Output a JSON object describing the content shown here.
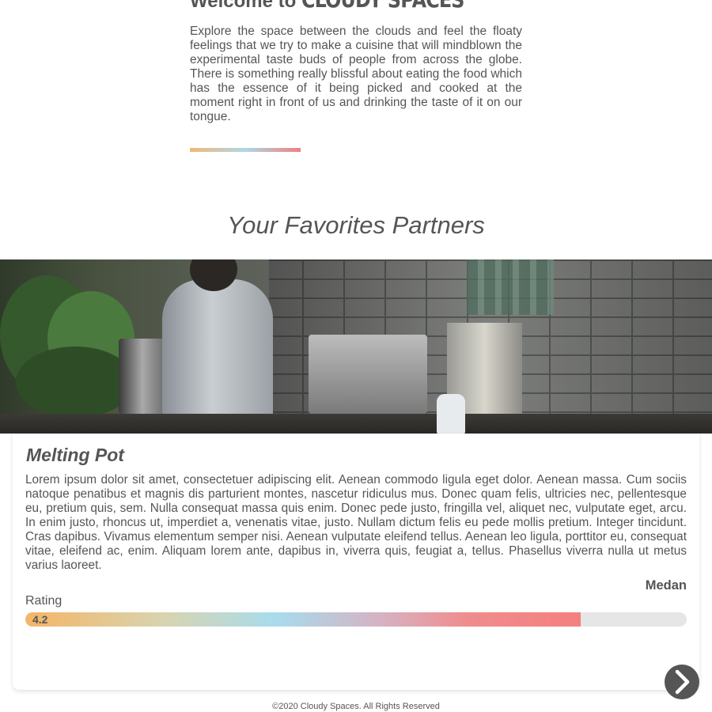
{
  "welcome": {
    "title_prefix": "Welcome to",
    "title_brand": "CLOUDY SPACES",
    "text": "Explore the space between the clouds and feel the floaty feelings that we try to make a cuisine that will mindblown the experimental taste buds of people from across the globe. There is something really blissful about eating the food which has the essence of it being picked and cooked at the moment right in front of us and drinking the taste of it on our tongue."
  },
  "partners": {
    "heading": "Your Favorites Partners",
    "card": {
      "name": "Melting Pot",
      "description": "Lorem ipsum dolor sit amet, consectetuer adipiscing elit. Aenean commodo ligula eget dolor. Aenean massa. Cum sociis natoque penatibus et magnis dis parturient montes, nascetur ridiculus mus. Donec quam felis, ultricies nec, pellentesque eu, pretium quis, sem. Nulla consequat massa quis enim. Donec pede justo, fringilla vel, aliquet nec, vulputate eget, arcu. In enim justo, rhoncus ut, imperdiet a, venenatis vitae, justo. Nullam dictum felis eu pede mollis pretium. Integer tincidunt. Cras dapibus. Vivamus elementum semper nisi. Aenean vulputate eleifend tellus. Aenean leo ligula, porttitor eu, consequat vitae, eleifend ac, enim. Aliquam lorem ante, dapibus in, viverra quis, feugiat a, tellus. Phasellus viverra nulla ut metus varius laoreet.",
      "location": "Medan",
      "rating_label": "Rating",
      "rating_value": "4.2",
      "rating_fraction": 0.84
    },
    "next_icon": "chevron-right-icon"
  },
  "footer": {
    "text": "©2020 Cloudy Spaces. All Rights Reserved"
  },
  "colors": {
    "text": "#555555",
    "gradient_orange": "#f0b877",
    "gradient_blue": "#add8e6",
    "gradient_red": "#f08080",
    "track": "#e6e6e6"
  }
}
